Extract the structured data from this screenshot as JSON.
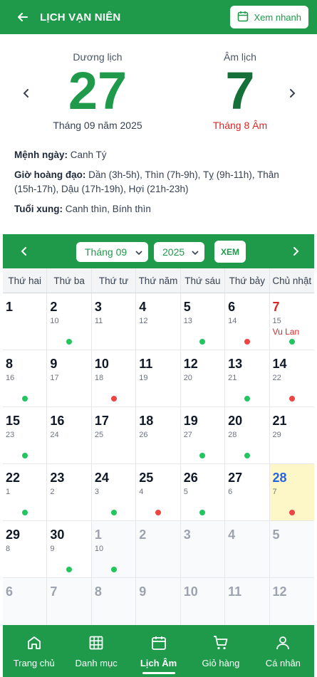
{
  "header": {
    "title": "LỊCH VẠN NIÊN",
    "quick_view_label": "Xem nhanh"
  },
  "hero": {
    "solar_label": "Dương lịch",
    "solar_day": "27",
    "solar_sub": "Tháng 09 năm 2025",
    "lunar_label": "Âm lịch",
    "lunar_day": "7",
    "lunar_sub": "Tháng 8 Âm"
  },
  "info": {
    "menh_label": "Mệnh ngày:",
    "menh_value": "Canh Tý",
    "gio_label": "Giờ hoàng đạo:",
    "gio_value": "Dần (3h-5h), Thìn (7h-9h), Tỵ (9h-11h), Thân (15h-17h), Dậu (17h-19h), Hợi (21h-23h)",
    "tuoi_label": "Tuổi xung:",
    "tuoi_value": "Canh thìn, Bính thìn"
  },
  "calendar_controls": {
    "month_value": "Tháng 09",
    "year_value": "2025",
    "view_button": "XEM"
  },
  "weekdays": [
    "Thứ hai",
    "Thứ ba",
    "Thứ tư",
    "Thứ năm",
    "Thứ sáu",
    "Thứ bảy",
    "Chủ nhật"
  ],
  "weeks": [
    [
      {
        "day": "1",
        "lunar": "",
        "dot": "",
        "type": "normal"
      },
      {
        "day": "2",
        "lunar": "10",
        "dot": "good",
        "type": "normal"
      },
      {
        "day": "3",
        "lunar": "11",
        "dot": "",
        "type": "normal"
      },
      {
        "day": "4",
        "lunar": "12",
        "dot": "",
        "type": "normal"
      },
      {
        "day": "5",
        "lunar": "13",
        "dot": "good",
        "type": "normal"
      },
      {
        "day": "6",
        "lunar": "14",
        "dot": "bad",
        "type": "normal"
      },
      {
        "day": "7",
        "lunar": "15",
        "dot": "good",
        "type": "sunday",
        "event": "Vu Lan"
      }
    ],
    [
      {
        "day": "8",
        "lunar": "16",
        "dot": "good",
        "type": "normal"
      },
      {
        "day": "9",
        "lunar": "17",
        "dot": "",
        "type": "normal"
      },
      {
        "day": "10",
        "lunar": "18",
        "dot": "bad",
        "type": "normal"
      },
      {
        "day": "11",
        "lunar": "19",
        "dot": "",
        "type": "normal"
      },
      {
        "day": "12",
        "lunar": "20",
        "dot": "",
        "type": "normal"
      },
      {
        "day": "13",
        "lunar": "21",
        "dot": "good",
        "type": "normal"
      },
      {
        "day": "14",
        "lunar": "22",
        "dot": "bad",
        "type": "normal"
      }
    ],
    [
      {
        "day": "15",
        "lunar": "23",
        "dot": "good",
        "type": "normal"
      },
      {
        "day": "16",
        "lunar": "24",
        "dot": "",
        "type": "normal"
      },
      {
        "day": "17",
        "lunar": "25",
        "dot": "",
        "type": "normal"
      },
      {
        "day": "18",
        "lunar": "26",
        "dot": "",
        "type": "normal"
      },
      {
        "day": "19",
        "lunar": "27",
        "dot": "good",
        "type": "normal"
      },
      {
        "day": "20",
        "lunar": "28",
        "dot": "good",
        "type": "normal"
      },
      {
        "day": "21",
        "lunar": "29",
        "dot": "",
        "type": "normal"
      }
    ],
    [
      {
        "day": "22",
        "lunar": "1",
        "dot": "good",
        "type": "normal"
      },
      {
        "day": "23",
        "lunar": "2",
        "dot": "",
        "type": "normal"
      },
      {
        "day": "24",
        "lunar": "3",
        "dot": "good",
        "type": "normal"
      },
      {
        "day": "25",
        "lunar": "4",
        "dot": "bad",
        "type": "normal"
      },
      {
        "day": "26",
        "lunar": "5",
        "dot": "good",
        "type": "normal"
      },
      {
        "day": "27",
        "lunar": "6",
        "dot": "",
        "type": "normal"
      },
      {
        "day": "28",
        "lunar": "7",
        "dot": "bad",
        "type": "today"
      }
    ],
    [
      {
        "day": "29",
        "lunar": "8",
        "dot": "",
        "type": "normal"
      },
      {
        "day": "30",
        "lunar": "9",
        "dot": "good",
        "type": "normal"
      },
      {
        "day": "1",
        "lunar": "10",
        "dot": "good",
        "type": "other"
      },
      {
        "day": "2",
        "lunar": "",
        "dot": "",
        "type": "other"
      },
      {
        "day": "3",
        "lunar": "",
        "dot": "",
        "type": "other"
      },
      {
        "day": "4",
        "lunar": "",
        "dot": "",
        "type": "other"
      },
      {
        "day": "5",
        "lunar": "",
        "dot": "",
        "type": "other"
      }
    ],
    [
      {
        "day": "6",
        "lunar": "",
        "dot": "",
        "type": "other"
      },
      {
        "day": "7",
        "lunar": "",
        "dot": "",
        "type": "other"
      },
      {
        "day": "8",
        "lunar": "",
        "dot": "",
        "type": "other"
      },
      {
        "day": "9",
        "lunar": "",
        "dot": "",
        "type": "other"
      },
      {
        "day": "10",
        "lunar": "",
        "dot": "",
        "type": "other"
      },
      {
        "day": "11",
        "lunar": "",
        "dot": "",
        "type": "other"
      },
      {
        "day": "12",
        "lunar": "",
        "dot": "",
        "type": "other"
      }
    ]
  ],
  "bottom_nav": [
    {
      "label": "Trang chủ",
      "icon": "home-icon",
      "active": false
    },
    {
      "label": "Danh mục",
      "icon": "grid-icon",
      "active": false
    },
    {
      "label": "Lịch Âm",
      "icon": "calendar-icon",
      "active": true
    },
    {
      "label": "Giỏ hàng",
      "icon": "cart-icon",
      "active": false
    },
    {
      "label": "Cá nhân",
      "icon": "user-icon",
      "active": false
    }
  ],
  "colors": {
    "brand": "#1e9a4a",
    "good_dot": "#22c55e",
    "bad_dot": "#ef4444",
    "today_bg": "#fdf6c7",
    "sunday_text": "#dc2626"
  }
}
